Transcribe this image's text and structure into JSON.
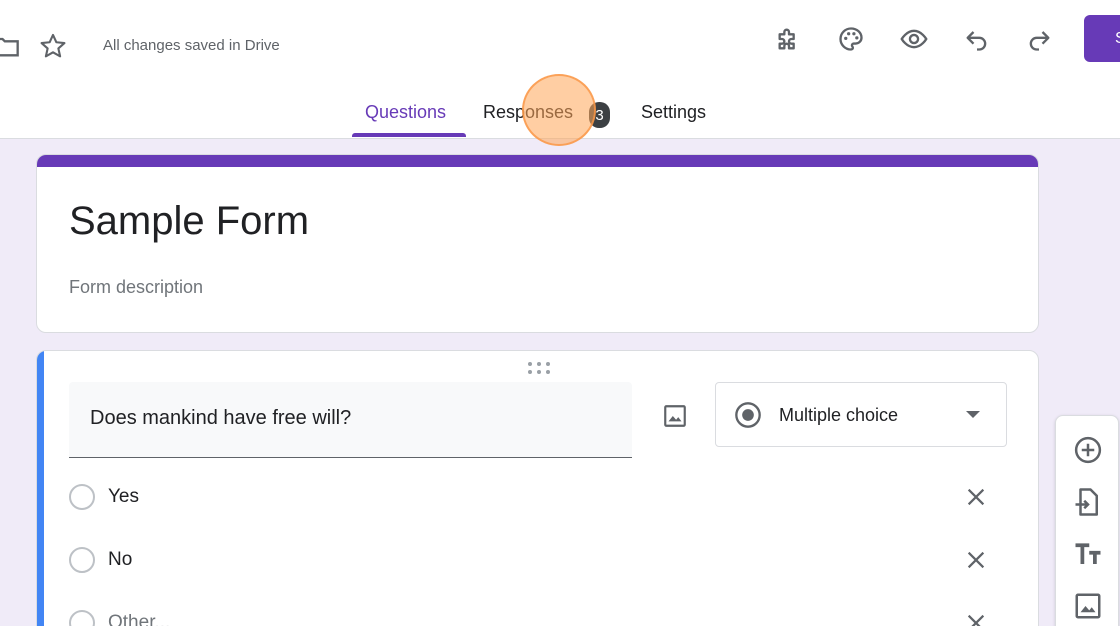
{
  "header": {
    "save_status": "All changes saved in Drive",
    "send_label": "Send",
    "icons": [
      "folder-icon",
      "star-icon",
      "addon-icon",
      "palette-icon",
      "preview-icon",
      "undo-icon",
      "redo-icon"
    ]
  },
  "tabs": [
    {
      "label": "Questions",
      "active": true
    },
    {
      "label": "Responses",
      "badge": "3"
    },
    {
      "label": "Settings"
    }
  ],
  "form": {
    "title": "Sample Form",
    "description_placeholder": "Form description"
  },
  "question": {
    "text": "Does mankind have free will?",
    "type": "Multiple choice",
    "options": [
      {
        "label": "Yes"
      },
      {
        "label": "No"
      },
      {
        "label": "Other..."
      }
    ]
  },
  "side_toolbar": {
    "tools": [
      "add-question-icon",
      "import-questions-icon",
      "add-title-icon",
      "add-image-icon"
    ]
  },
  "colors": {
    "accent": "#673ab7",
    "question_bar": "#4285f4",
    "background": "#f0ebf8",
    "click_highlight": "#ffa657"
  }
}
